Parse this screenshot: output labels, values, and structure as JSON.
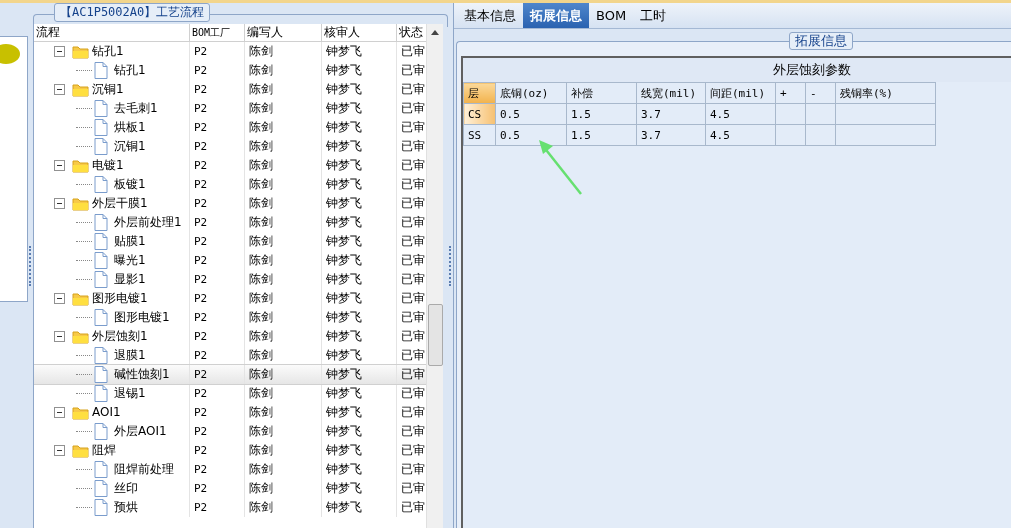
{
  "process": {
    "title": "【AC1P5002A0】工艺流程",
    "columns": [
      "流程",
      "BOM工厂",
      "编写人",
      "核审人",
      "状态"
    ],
    "tree": [
      {
        "name": "钻孔1",
        "bom": "P2",
        "writer": "陈剑",
        "reviewer": "钟梦飞",
        "status": "已审",
        "expanded": true,
        "selected": false,
        "children": [
          {
            "name": "钻孔1",
            "bom": "P2",
            "writer": "陈剑",
            "reviewer": "钟梦飞",
            "status": "已审",
            "selected": false
          }
        ]
      },
      {
        "name": "沉铜1",
        "bom": "P2",
        "writer": "陈剑",
        "reviewer": "钟梦飞",
        "status": "已审",
        "expanded": true,
        "selected": false,
        "children": [
          {
            "name": "去毛刺1",
            "bom": "P2",
            "writer": "陈剑",
            "reviewer": "钟梦飞",
            "status": "已审",
            "selected": false
          },
          {
            "name": "烘板1",
            "bom": "P2",
            "writer": "陈剑",
            "reviewer": "钟梦飞",
            "status": "已审",
            "selected": false
          },
          {
            "name": "沉铜1",
            "bom": "P2",
            "writer": "陈剑",
            "reviewer": "钟梦飞",
            "status": "已审",
            "selected": false
          }
        ]
      },
      {
        "name": "电镀1",
        "bom": "P2",
        "writer": "陈剑",
        "reviewer": "钟梦飞",
        "status": "已审",
        "expanded": true,
        "selected": false,
        "children": [
          {
            "name": "板镀1",
            "bom": "P2",
            "writer": "陈剑",
            "reviewer": "钟梦飞",
            "status": "已审",
            "selected": false
          }
        ]
      },
      {
        "name": "外层干膜1",
        "bom": "P2",
        "writer": "陈剑",
        "reviewer": "钟梦飞",
        "status": "已审",
        "expanded": true,
        "selected": false,
        "children": [
          {
            "name": "外层前处理1",
            "bom": "P2",
            "writer": "陈剑",
            "reviewer": "钟梦飞",
            "status": "已审",
            "selected": false
          },
          {
            "name": "贴膜1",
            "bom": "P2",
            "writer": "陈剑",
            "reviewer": "钟梦飞",
            "status": "已审",
            "selected": false
          },
          {
            "name": "曝光1",
            "bom": "P2",
            "writer": "陈剑",
            "reviewer": "钟梦飞",
            "status": "已审",
            "selected": false
          },
          {
            "name": "显影1",
            "bom": "P2",
            "writer": "陈剑",
            "reviewer": "钟梦飞",
            "status": "已审",
            "selected": false
          }
        ]
      },
      {
        "name": "图形电镀1",
        "bom": "P2",
        "writer": "陈剑",
        "reviewer": "钟梦飞",
        "status": "已审",
        "expanded": true,
        "selected": false,
        "children": [
          {
            "name": "图形电镀1",
            "bom": "P2",
            "writer": "陈剑",
            "reviewer": "钟梦飞",
            "status": "已审",
            "selected": false
          }
        ]
      },
      {
        "name": "外层蚀刻1",
        "bom": "P2",
        "writer": "陈剑",
        "reviewer": "钟梦飞",
        "status": "已审",
        "expanded": true,
        "selected": false,
        "children": [
          {
            "name": "退膜1",
            "bom": "P2",
            "writer": "陈剑",
            "reviewer": "钟梦飞",
            "status": "已审",
            "selected": false
          },
          {
            "name": "碱性蚀刻1",
            "bom": "P2",
            "writer": "陈剑",
            "reviewer": "钟梦飞",
            "status": "已审",
            "selected": true
          },
          {
            "name": "退锡1",
            "bom": "P2",
            "writer": "陈剑",
            "reviewer": "钟梦飞",
            "status": "已审",
            "selected": false
          }
        ]
      },
      {
        "name": "AOI1",
        "bom": "P2",
        "writer": "陈剑",
        "reviewer": "钟梦飞",
        "status": "已审",
        "expanded": true,
        "selected": false,
        "children": [
          {
            "name": "外层AOI1",
            "bom": "P2",
            "writer": "陈剑",
            "reviewer": "钟梦飞",
            "status": "已审",
            "selected": false
          }
        ]
      },
      {
        "name": "阻焊",
        "bom": "P2",
        "writer": "陈剑",
        "reviewer": "钟梦飞",
        "status": "已审",
        "expanded": true,
        "selected": false,
        "children": [
          {
            "name": "阻焊前处理",
            "bom": "P2",
            "writer": "陈剑",
            "reviewer": "钟梦飞",
            "status": "已审",
            "selected": false
          },
          {
            "name": "丝印",
            "bom": "P2",
            "writer": "陈剑",
            "reviewer": "钟梦飞",
            "status": "已审",
            "selected": false
          },
          {
            "name": "预烘",
            "bom": "P2",
            "writer": "陈剑",
            "reviewer": "钟梦飞",
            "status": "已审",
            "selected": false
          }
        ]
      }
    ]
  },
  "tabs": [
    {
      "label": "基本信息",
      "selected": false
    },
    {
      "label": "拓展信息",
      "selected": true
    },
    {
      "label": "BOM",
      "selected": false
    },
    {
      "label": "工时",
      "selected": false
    }
  ],
  "extension": {
    "title": "拓展信息",
    "group_header": "外层蚀刻参数",
    "columns": [
      "层",
      "底铜(oz)",
      "补偿",
      "线宽(mil)",
      "间距(mil)",
      "+",
      "-",
      "残铜率(%)"
    ],
    "rows": [
      {
        "selected": true,
        "cells": [
          "CS",
          "0.5",
          "1.5",
          "3.7",
          "4.5",
          "",
          "",
          ""
        ]
      },
      {
        "selected": false,
        "cells": [
          "SS",
          "0.5",
          "1.5",
          "3.7",
          "4.5",
          "",
          "",
          ""
        ]
      }
    ]
  }
}
